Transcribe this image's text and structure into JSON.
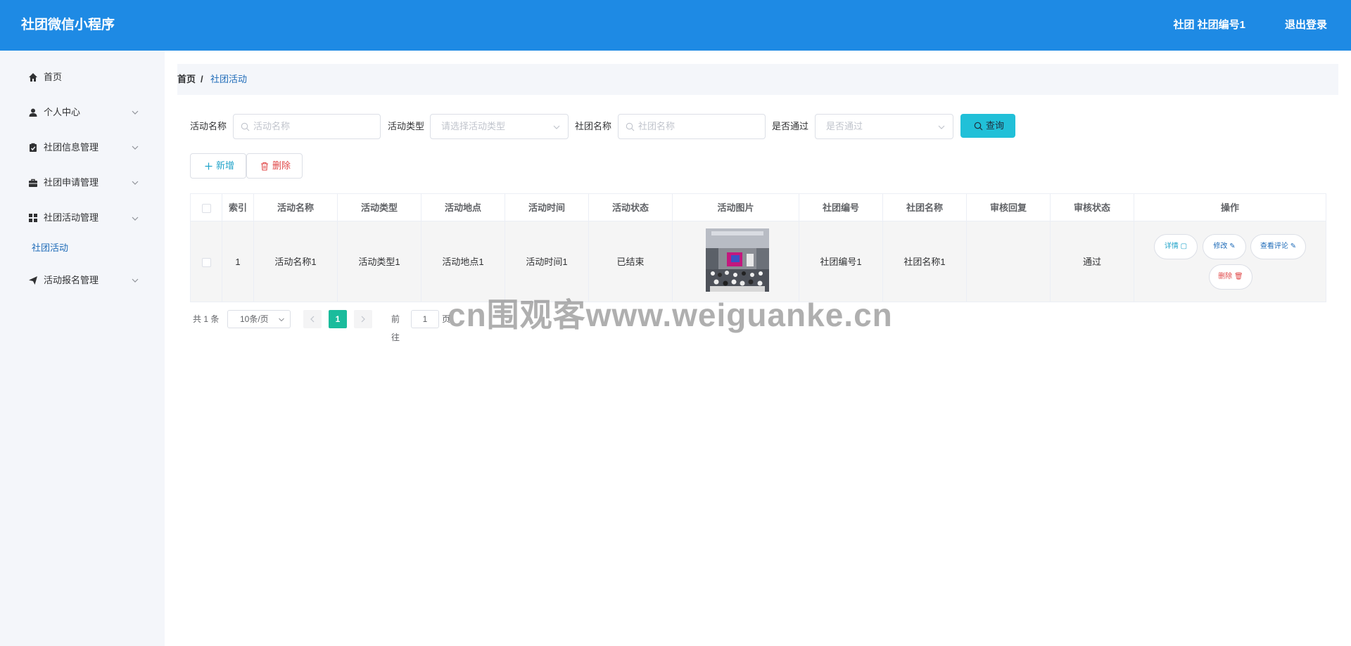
{
  "header": {
    "app_title": "社团微信小程序",
    "user_label": "社团 社团编号1",
    "logout_label": "退出登录"
  },
  "sidebar": {
    "items": [
      {
        "label": "首页",
        "icon": "home-icon"
      },
      {
        "label": "个人中心",
        "icon": "user-icon"
      },
      {
        "label": "社团信息管理",
        "icon": "clipboard-icon"
      },
      {
        "label": "社团申请管理",
        "icon": "briefcase-icon"
      },
      {
        "label": "社团活动管理",
        "icon": "grid-icon"
      },
      {
        "label": "活动报名管理",
        "icon": "send-icon"
      }
    ],
    "active_sub": "社团活动"
  },
  "breadcrumb": {
    "home": "首页",
    "separator": "/",
    "current": "社团活动"
  },
  "filters": {
    "activity_name": {
      "label": "活动名称",
      "placeholder": "活动名称"
    },
    "activity_type": {
      "label": "活动类型",
      "placeholder": "请选择活动类型"
    },
    "club_name": {
      "label": "社团名称",
      "placeholder": "社团名称"
    },
    "approved": {
      "label": "是否通过",
      "placeholder": "是否通过"
    },
    "query_label": "查询"
  },
  "toolbar": {
    "add_label": "新增",
    "delete_label": "删除"
  },
  "table": {
    "columns": [
      "索引",
      "活动名称",
      "活动类型",
      "活动地点",
      "活动时间",
      "活动状态",
      "活动图片",
      "社团编号",
      "社团名称",
      "审核回复",
      "审核状态",
      "操作"
    ],
    "rows": [
      {
        "index": "1",
        "activity_name": "活动名称1",
        "activity_type": "活动类型1",
        "location": "活动地点1",
        "time": "活动时间1",
        "status": "已结束",
        "club_no": "社团编号1",
        "club_name": "社团名称1",
        "review_reply": "",
        "review_status": "通过",
        "actions": {
          "detail": "详情",
          "edit": "修改",
          "comments": "查看评论",
          "delete": "删除"
        }
      }
    ]
  },
  "pagination": {
    "total_text": "共 1 条",
    "page_size": "10条/页",
    "current_page": "1",
    "goto_label": "前往",
    "jump_value": "1",
    "page_unit": "页"
  },
  "watermark": "cn围观客www.weiguanke.cn",
  "colors": {
    "header_bg": "#1e8ae4",
    "sidebar_bg": "#f4f6fa",
    "query_button": "#21c0d8",
    "pager_active": "#1abc9c",
    "danger": "#e04848"
  }
}
